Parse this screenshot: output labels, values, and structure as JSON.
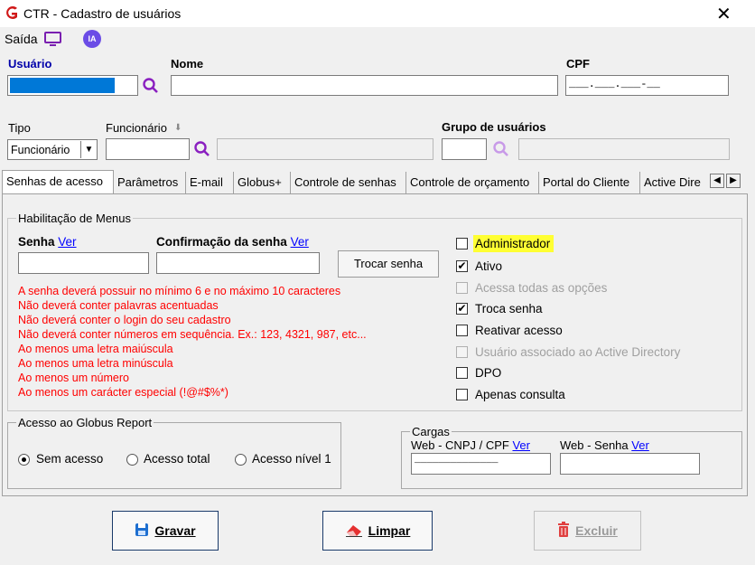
{
  "window": {
    "title": "CTR - Cadastro de usuários"
  },
  "toolbar": {
    "saida": "Saída",
    "ia": "IA"
  },
  "header": {
    "usuario_label": "Usuário",
    "nome_label": "Nome",
    "cpf_label": "CPF",
    "cpf_mask": "___.___.___-__",
    "tipo_label": "Tipo",
    "tipo_value": "Funcionário",
    "funcionario_label": "Funcionário",
    "grupo_label": "Grupo de usuários"
  },
  "tabs": [
    "Senhas de acesso",
    "Parâmetros",
    "E-mail",
    "Globus+",
    "Controle de senhas",
    "Controle de orçamento",
    "Portal do Cliente",
    "Active Dire"
  ],
  "menus_group": {
    "title": "Habilitação de Menus",
    "senha_label": "Senha",
    "confirm_label": "Confirmação da senha",
    "ver": "Ver",
    "trocar_btn": "Trocar senha",
    "rules": [
      "A senha deverá possuir no mínimo 6 e no máximo 10 caracteres",
      "Não deverá conter palavras acentuadas",
      "Não deverá conter o login do seu cadastro",
      "Não deverá conter números em sequência. Ex.: 123, 4321, 987, etc...",
      "Ao menos uma letra maiúscula",
      "Ao menos uma letra minúscula",
      "Ao menos um número",
      "Ao menos um carácter especial (!@#$%*)"
    ]
  },
  "checkboxes": {
    "administrador": "Administrador",
    "ativo": "Ativo",
    "acessa_todas": "Acessa todas as opções",
    "troca_senha": "Troca senha",
    "reativar": "Reativar acesso",
    "usuario_ad": "Usuário associado ao Active Directory",
    "dpo": "DPO",
    "apenas_consulta": "Apenas consulta"
  },
  "report_group": {
    "title": "Acesso ao Globus Report",
    "options": [
      "Sem acesso",
      "Acesso total",
      "Acesso nível 1"
    ]
  },
  "cargas_group": {
    "title": "Cargas",
    "cnpj_label": "Web - CNPJ / CPF",
    "cnpj_mask": "______________",
    "senha_label": "Web - Senha",
    "ver": "Ver"
  },
  "buttons": {
    "gravar": "Gravar",
    "limpar": "Limpar",
    "excluir": "Excluir"
  },
  "colors": {
    "accent_blue": "#0000aa",
    "error_red": "#ff0000",
    "highlight": "#ffff33",
    "selection": "#0078d7"
  }
}
